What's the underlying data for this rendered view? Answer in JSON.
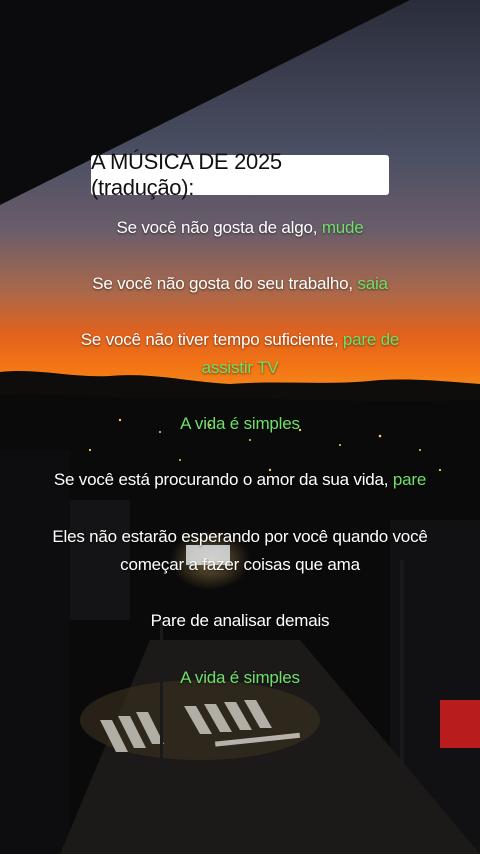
{
  "title": "A MÚSICA DE 2025 (tradução):",
  "lines": [
    {
      "white": "Se você não gosta de algo, ",
      "green": "mude"
    },
    {
      "white": "Se você não gosta do seu trabalho, ",
      "green": "saia"
    },
    {
      "white": "Se você não tiver tempo suficiente, ",
      "green": "pare de"
    },
    {
      "green": "assistir TV"
    },
    {
      "green": "A vida é simples"
    },
    {
      "white": "Se você está procurando o amor da sua vida, ",
      "green": "pare"
    },
    {
      "white": "Eles não estarão esperando por você quando você"
    },
    {
      "white": "começar a fazer coisas que ama"
    },
    {
      "white": "Pare de analisar demais"
    },
    {
      "green": "A vida é simples"
    }
  ],
  "colors": {
    "highlight": "#6ee06a",
    "title_bg": "#ffffff",
    "text": "#ffffff"
  }
}
